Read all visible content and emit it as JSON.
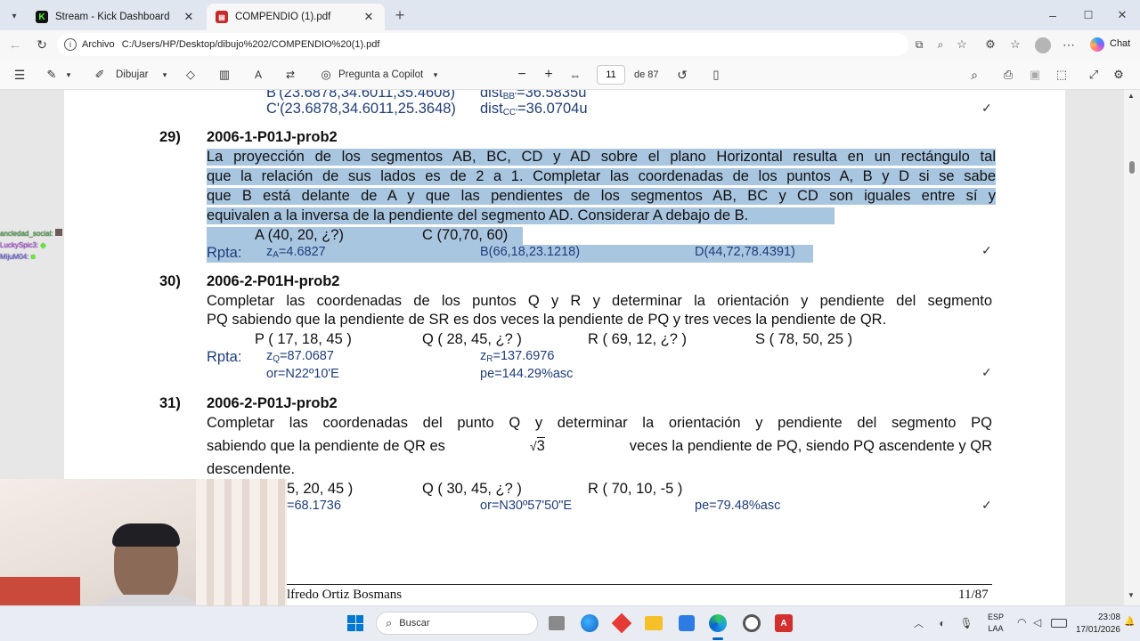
{
  "browser": {
    "tabs": [
      {
        "title": "Stream - Kick Dashboard",
        "icon": "kick-icon",
        "favicon_letter": "K",
        "active": false
      },
      {
        "title": "COMPENDIO (1).pdf",
        "icon": "pdf-icon",
        "active": true
      }
    ],
    "address": {
      "label": "Archivo",
      "url": "C:/Users/HP/Desktop/dibujo%202/COMPENDIO%20(1).pdf"
    },
    "chat_label": "Chat"
  },
  "pdf_toolbar": {
    "draw_label": "Dibujar",
    "copilot_label": "Pregunta a Copilot",
    "page_current": "11",
    "page_total": "de 87"
  },
  "document": {
    "top_rows": [
      {
        "point": "B'(23.6878,34.6011,35.4608)",
        "dist": "dist",
        "dist_sub": "BB'",
        "dist_val": "=36.5835u"
      },
      {
        "point": "C'(23.6878,34.6011,25.3648)",
        "dist": "dist",
        "dist_sub": "CC'",
        "dist_val": "=36.0704u"
      }
    ],
    "problems": [
      {
        "number": "29)",
        "code": "2006-1-P01J-prob2",
        "text_lines": [
          "La proyección de los segmentos AB, BC, CD y AD sobre el plano Horizontal resulta en un rectángulo tal",
          "que la relación de sus lados es de 2 a 1. Completar las coordenadas de los puntos A, B y D si se sabe",
          "que B está delante de A y que las pendientes de los segmentos AB, BC y CD son iguales entre sí y",
          "equivalen a la inversa de la pendiente del segmento AD. Considerar A debajo de B."
        ],
        "points": [
          "A (40, 20, ¿?)",
          "C (70,70, 60)"
        ],
        "rpta_label": "Rpta:",
        "answers": [
          "z",
          "A",
          "=4.6827",
          "B(66,18,23.1218)",
          "D(44,72,78.4391)"
        ]
      },
      {
        "number": "30)",
        "code": "2006-2-P01H-prob2",
        "text_lines": [
          "Completar las coordenadas de los puntos Q y R y determinar la orientación y pendiente del segmento",
          "PQ sabiendo que la pendiente de SR es dos veces la pendiente de PQ y tres veces la pendiente de QR."
        ],
        "points": [
          "P ( 17, 18, 45 )",
          "Q ( 28, 45, ¿? )",
          "R ( 69, 12, ¿? )",
          "S ( 78, 50, 25 )"
        ],
        "rpta_label": "Rpta:",
        "answers": [
          "z",
          "Q",
          "=87.0687",
          "z",
          "R",
          "=137.6976",
          "or=N22º10'E",
          "pe=144.29%asc"
        ]
      },
      {
        "number": "31)",
        "code": "2006-2-P01J-prob2",
        "text_lines": [
          "Completar las coordenadas del punto Q y determinar la orientación y pendiente del segmento PQ",
          "sabiendo que la pendiente de QR es",
          "3",
          "veces la pendiente de PQ, siendo PQ ascendente y QR",
          "descendente."
        ],
        "points": [
          "5, 20, 45 )",
          "Q ( 30, 45, ¿? )",
          "R ( 70, 10, -5 )"
        ],
        "answers": [
          "=68.1736",
          "or=N30º57'50\"E",
          "pe=79.48%asc"
        ]
      }
    ],
    "footer": {
      "author": "lfredo Ortiz Bosmans",
      "page": "11/87"
    },
    "check": "✓"
  },
  "chat_overlay": [
    "ancledad_social:",
    "LuckySpic3:",
    "MijuM04:"
  ],
  "taskbar": {
    "search_placeholder": "Buscar",
    "lang": "ESP",
    "region": "LAA",
    "time": "23:08",
    "date": "17/01/2026"
  },
  "colors": {
    "selection": "#a9c6e1",
    "accent": "#0067c0",
    "kick_green": "#53fc18"
  }
}
